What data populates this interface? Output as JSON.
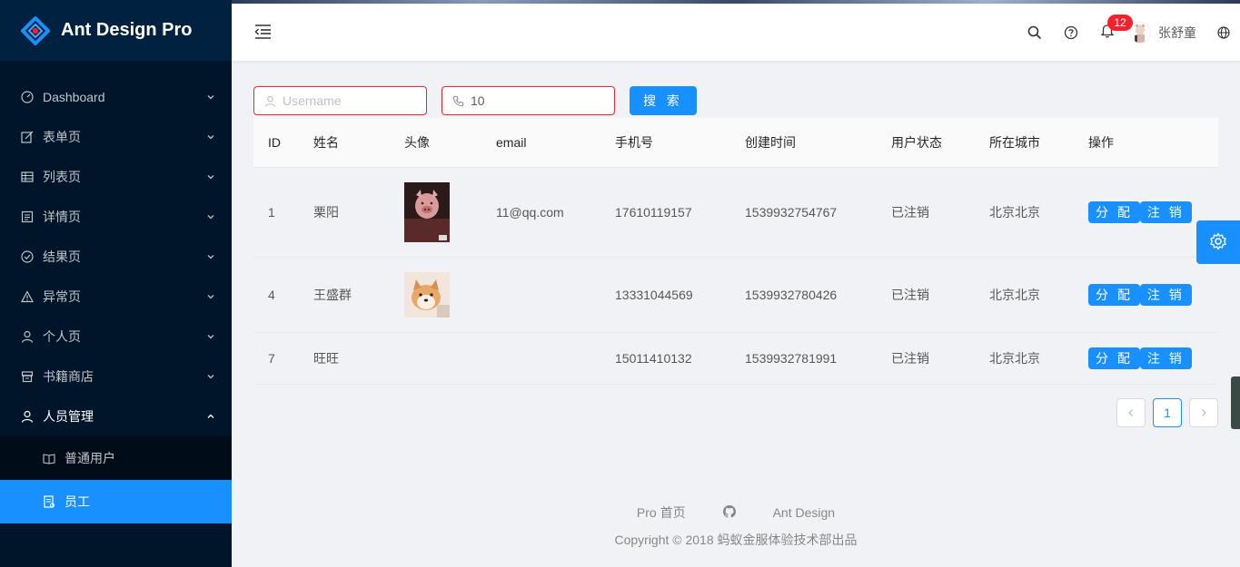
{
  "app": {
    "title": "Ant Design Pro"
  },
  "sidebar": {
    "items": [
      {
        "label": "Dashboard",
        "icon": "dashboard-icon"
      },
      {
        "label": "表单页",
        "icon": "form-icon"
      },
      {
        "label": "列表页",
        "icon": "table-icon"
      },
      {
        "label": "详情页",
        "icon": "profile-icon"
      },
      {
        "label": "结果页",
        "icon": "check-circle-icon"
      },
      {
        "label": "异常页",
        "icon": "warning-icon"
      },
      {
        "label": "个人页",
        "icon": "user-icon"
      },
      {
        "label": "书籍商店",
        "icon": "shop-icon"
      },
      {
        "label": "人员管理",
        "icon": "user-icon"
      }
    ],
    "subitems": [
      {
        "label": "普通用户",
        "icon": "book-icon"
      },
      {
        "label": "员工",
        "icon": "file-icon"
      }
    ]
  },
  "header": {
    "notification_count": "12",
    "user_name": "张舒童"
  },
  "search": {
    "username_placeholder": "Username",
    "phone_value": "10",
    "button_label": "搜 索"
  },
  "table": {
    "columns": [
      "ID",
      "姓名",
      "头像",
      "email",
      "手机号",
      "创建时间",
      "用户状态",
      "所在城市",
      "操作"
    ],
    "rows": [
      {
        "id": "1",
        "name": "栗阳",
        "avatar": "pig-mask-photo",
        "email": "11@qq.com",
        "phone": "17610119157",
        "created": "1539932754767",
        "status": "已注销",
        "city": "北京北京"
      },
      {
        "id": "4",
        "name": "王盛群",
        "avatar": "shiba-dog-photo",
        "email": "",
        "phone": "13331044569",
        "created": "1539932780426",
        "status": "已注销",
        "city": "北京北京"
      },
      {
        "id": "7",
        "name": "旺旺",
        "avatar": "",
        "email": "",
        "phone": "15011410132",
        "created": "1539932781991",
        "status": "已注销",
        "city": "北京北京"
      }
    ],
    "assign_label": "分 配",
    "cancel_label": "注 销"
  },
  "pagination": {
    "current": "1"
  },
  "footer": {
    "links": [
      "Pro 首页",
      "Ant Design"
    ],
    "copyright": "Copyright © 2018 蚂蚁金服体验技术部出品"
  },
  "colors": {
    "primary": "#1890ff",
    "sider": "#001529",
    "error": "#f5222d"
  }
}
